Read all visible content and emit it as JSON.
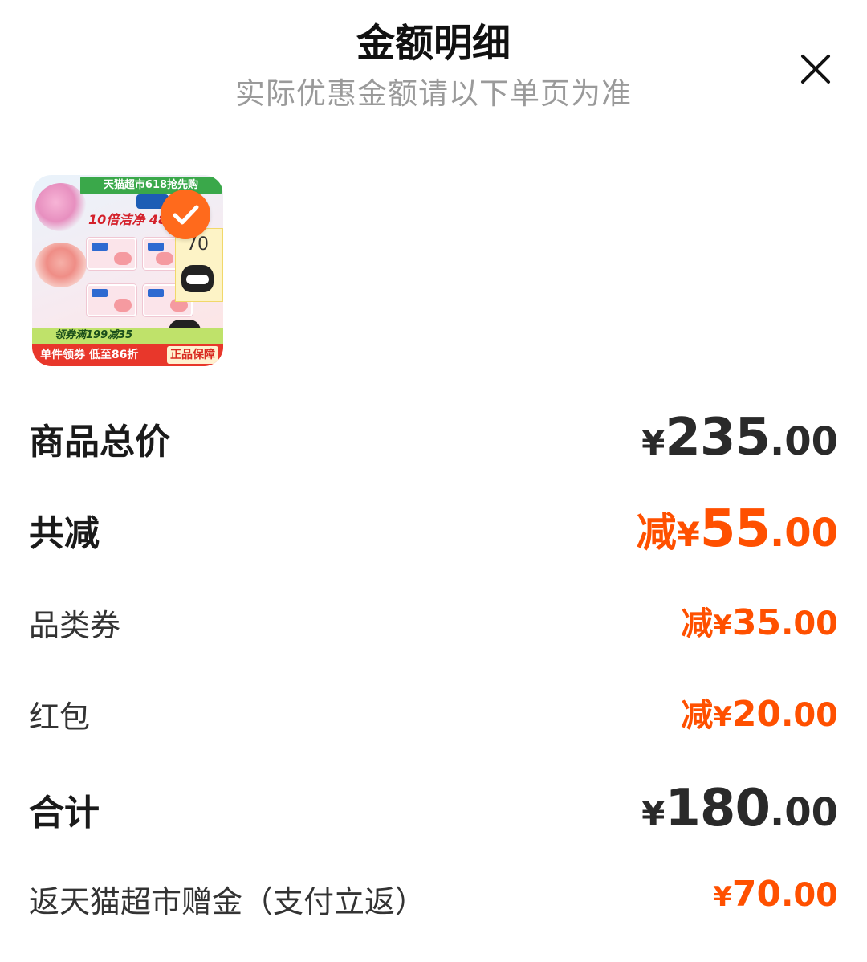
{
  "header": {
    "title": "金额明细",
    "subtitle": "实际优惠金额请以下单页为准",
    "close_icon": "close-icon"
  },
  "product": {
    "image_icon": "product-thumbnail",
    "banner": "天猫超市618抢先购",
    "headline": "10倍洁净 48",
    "side_number": "70",
    "coupon_strip": "领券满199减35",
    "bottom_left": "单件领券 低至86折",
    "bottom_right": "正品保障",
    "selected_icon": "check-icon"
  },
  "rows": {
    "total": {
      "label": "商品总价",
      "prefix": "",
      "symbol": "¥",
      "int": "235",
      "dec": ".00"
    },
    "discount": {
      "label": "共减",
      "prefix": "减",
      "symbol": "¥",
      "int": "55",
      "dec": ".00"
    },
    "coupon": {
      "label": "品类券",
      "prefix": "减",
      "symbol": "¥",
      "int": "35",
      "dec": ".00"
    },
    "redpacket": {
      "label": "红包",
      "prefix": "减",
      "symbol": "¥",
      "int": "20",
      "dec": ".00"
    },
    "sum": {
      "label": "合计",
      "prefix": "",
      "symbol": "¥",
      "int": "180",
      "dec": ".00"
    },
    "rebate": {
      "label": "返天猫超市赠金（支付立返）",
      "prefix": "",
      "symbol": "¥",
      "int": "70",
      "dec": ".00"
    }
  },
  "colors": {
    "accent_orange": "#ff5000",
    "text_dark": "#1a1a1a",
    "subtitle_gray": "#9a9a9a",
    "badge_orange": "#ff6a1c"
  }
}
